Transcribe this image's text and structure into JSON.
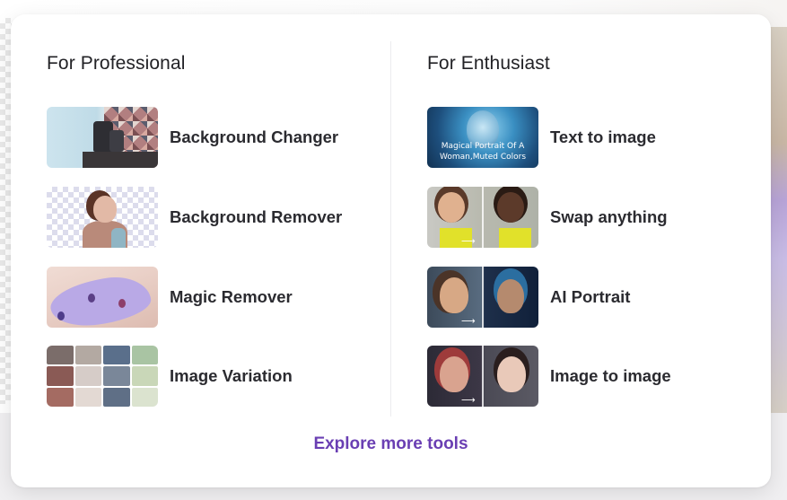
{
  "professional": {
    "title": "For Professional",
    "items": [
      {
        "label": "Background Changer",
        "icon": "background-changer-thumbnail"
      },
      {
        "label": "Background Remover",
        "icon": "background-remover-thumbnail"
      },
      {
        "label": "Magic Remover",
        "icon": "magic-remover-thumbnail"
      },
      {
        "label": "Image Variation",
        "icon": "image-variation-thumbnail"
      }
    ]
  },
  "enthusiast": {
    "title": "For Enthusiast",
    "items": [
      {
        "label": "Text to image",
        "icon": "text-to-image-thumbnail",
        "thumb_caption": "Magical Portrait Of A Woman,Muted Colors"
      },
      {
        "label": "Swap anything",
        "icon": "swap-anything-thumbnail"
      },
      {
        "label": "AI Portrait",
        "icon": "ai-portrait-thumbnail"
      },
      {
        "label": "Image to image",
        "icon": "image-to-image-thumbnail"
      }
    ]
  },
  "explore_label": "Explore more tools",
  "colors": {
    "accent": "#6a3fb3",
    "text": "#2b2b30",
    "panel_bg": "#ffffff"
  }
}
